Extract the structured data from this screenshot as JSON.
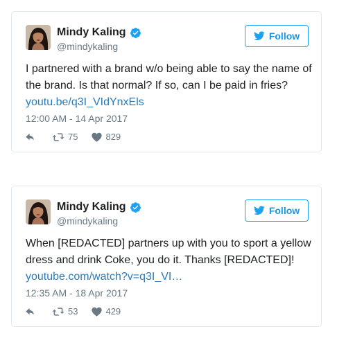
{
  "colors": {
    "brand_blue": "#1da1f2",
    "link_blue": "#2b7bb9",
    "text": "#1c2022",
    "muted": "#697882",
    "border": "#e1e8ed"
  },
  "tweets": [
    {
      "author": {
        "name": "Mindy Kaling",
        "handle": "@mindykaling",
        "avatar_icon": "avatar-photo",
        "verified_icon": "verified-badge-icon"
      },
      "follow_label": "Follow",
      "text_line": "I partnered with a brand w/o being able to say the name of the brand. Is that normal? If so, can I be paid in fries?",
      "link": "youtu.be/q3I_VIdYnxEls",
      "timestamp": "12:00 AM - 14 Apr 2017",
      "retweets": "75",
      "likes": "829"
    },
    {
      "author": {
        "name": "Mindy Kaling",
        "handle": "@mindykaling",
        "avatar_icon": "avatar-photo",
        "verified_icon": "verified-badge-icon"
      },
      "follow_label": "Follow",
      "text_line": "When [REDACTED] partners up with you to sport a yellow dress and drink Coke, you do it. Thanks [REDACTED]!",
      "link": "youtube.com/watch?v=q3I_VI…",
      "timestamp": "12:35 AM - 18 Apr 2017",
      "retweets": "53",
      "likes": "429"
    }
  ]
}
